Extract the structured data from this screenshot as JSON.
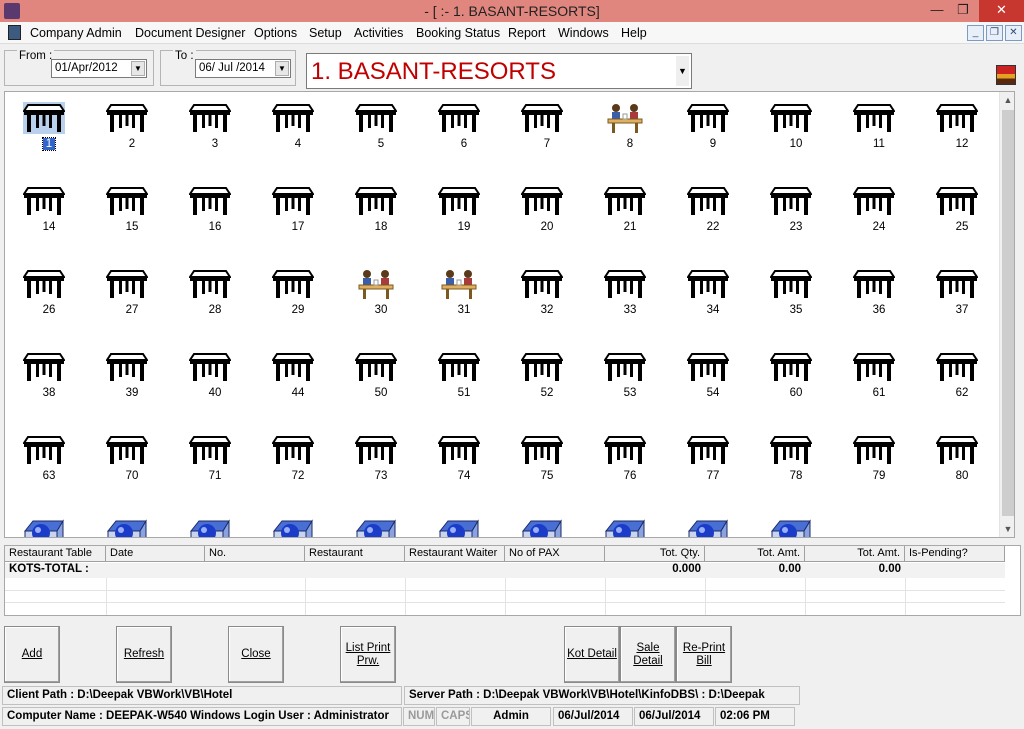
{
  "window": {
    "title": "- [ :- 1. BASANT-RESORTS]",
    "minimize_glyph": "—",
    "restore_glyph": "❐",
    "close_glyph": "✕"
  },
  "menu": {
    "items": [
      "Company Admin",
      "Document Designer",
      "Options",
      "Setup",
      "Activities",
      "Booking Status",
      "Report",
      "Windows",
      "Help"
    ],
    "mdi_minimize": "_",
    "mdi_restore": "❐",
    "mdi_close": "✕"
  },
  "filters": {
    "from_label": "From :",
    "from_value": "01/Apr/2012",
    "to_label": "To :",
    "to_value": "06/ Jul /2014",
    "resort_value": "1. BASANT-RESORTS",
    "dropdown_glyph": "▼"
  },
  "tables": [
    {
      "label": "1",
      "status": "selected"
    },
    {
      "label": "2",
      "status": "free"
    },
    {
      "label": "3",
      "status": "free"
    },
    {
      "label": "4",
      "status": "free"
    },
    {
      "label": "5",
      "status": "free"
    },
    {
      "label": "6",
      "status": "free"
    },
    {
      "label": "7",
      "status": "free"
    },
    {
      "label": "8",
      "status": "occupied"
    },
    {
      "label": "9",
      "status": "free"
    },
    {
      "label": "10",
      "status": "free"
    },
    {
      "label": "11",
      "status": "free"
    },
    {
      "label": "12",
      "status": "free"
    },
    {
      "label": "14",
      "status": "free"
    },
    {
      "label": "15",
      "status": "free"
    },
    {
      "label": "16",
      "status": "free"
    },
    {
      "label": "17",
      "status": "free"
    },
    {
      "label": "18",
      "status": "free"
    },
    {
      "label": "19",
      "status": "free"
    },
    {
      "label": "20",
      "status": "free"
    },
    {
      "label": "21",
      "status": "free"
    },
    {
      "label": "22",
      "status": "free"
    },
    {
      "label": "23",
      "status": "free"
    },
    {
      "label": "24",
      "status": "free"
    },
    {
      "label": "25",
      "status": "free"
    },
    {
      "label": "26",
      "status": "free"
    },
    {
      "label": "27",
      "status": "free"
    },
    {
      "label": "28",
      "status": "free"
    },
    {
      "label": "29",
      "status": "free"
    },
    {
      "label": "30",
      "status": "occupied"
    },
    {
      "label": "31",
      "status": "occupied"
    },
    {
      "label": "32",
      "status": "free"
    },
    {
      "label": "33",
      "status": "free"
    },
    {
      "label": "34",
      "status": "free"
    },
    {
      "label": "35",
      "status": "free"
    },
    {
      "label": "36",
      "status": "free"
    },
    {
      "label": "37",
      "status": "free"
    },
    {
      "label": "38",
      "status": "free"
    },
    {
      "label": "39",
      "status": "free"
    },
    {
      "label": "40",
      "status": "free"
    },
    {
      "label": "44",
      "status": "free"
    },
    {
      "label": "50",
      "status": "free"
    },
    {
      "label": "51",
      "status": "free"
    },
    {
      "label": "52",
      "status": "free"
    },
    {
      "label": "53",
      "status": "free"
    },
    {
      "label": "54",
      "status": "free"
    },
    {
      "label": "60",
      "status": "free"
    },
    {
      "label": "61",
      "status": "free"
    },
    {
      "label": "62",
      "status": "free"
    },
    {
      "label": "63",
      "status": "free"
    },
    {
      "label": "70",
      "status": "free"
    },
    {
      "label": "71",
      "status": "free"
    },
    {
      "label": "72",
      "status": "free"
    },
    {
      "label": "73",
      "status": "free"
    },
    {
      "label": "74",
      "status": "free"
    },
    {
      "label": "75",
      "status": "free"
    },
    {
      "label": "76",
      "status": "free"
    },
    {
      "label": "77",
      "status": "free"
    },
    {
      "label": "78",
      "status": "free"
    },
    {
      "label": "79",
      "status": "free"
    },
    {
      "label": "80",
      "status": "free"
    },
    {
      "label": "",
      "status": "room"
    },
    {
      "label": "",
      "status": "room"
    },
    {
      "label": "",
      "status": "room"
    },
    {
      "label": "",
      "status": "room"
    },
    {
      "label": "",
      "status": "room"
    },
    {
      "label": "",
      "status": "room"
    },
    {
      "label": "",
      "status": "room"
    },
    {
      "label": "",
      "status": "room"
    },
    {
      "label": "",
      "status": "room"
    },
    {
      "label": "",
      "status": "room"
    }
  ],
  "icons": {
    "free": "dining-table-icon",
    "occupied": "occupied-table-icon",
    "selected": "selected-table-icon",
    "room": "room-icon"
  },
  "kot": {
    "headers": [
      "Restaurant Table",
      "Date",
      "No.",
      "Restaurant",
      "Restaurant Waiter",
      "No of PAX",
      "Tot. Qty.",
      "Tot. Amt.",
      "Tot. Amt.",
      "Is-Pending?"
    ],
    "total_label": "KOTS-TOTAL :",
    "total_qty": "0.000",
    "total_amt1": "0.00",
    "total_amt2": "0.00"
  },
  "buttons": {
    "add": "Add",
    "refresh": "Refresh",
    "close": "Close",
    "list_print_1": "List Print",
    "list_print_2": "Prw.",
    "kot_detail": "Kot Detail",
    "sale_detail_1": "Sale",
    "sale_detail_2": "Detail",
    "reprint_1": "Re-Print",
    "reprint_2": "Bill"
  },
  "status": {
    "client_path": "Client Path : D:\\Deepak VBWork\\VB\\Hotel",
    "server_path": "Server Path : D:\\Deepak VBWork\\VB\\Hotel\\KinfoDBS\\ : D:\\Deepak",
    "computer_name": "Computer Name : DEEPAK-W540    Windows Login User : Administrator",
    "num": "NUM",
    "caps": "CAPS",
    "user": "Admin",
    "date1": "06/Jul/2014",
    "date2": "06/Jul/2014",
    "time": "02:06 PM"
  }
}
